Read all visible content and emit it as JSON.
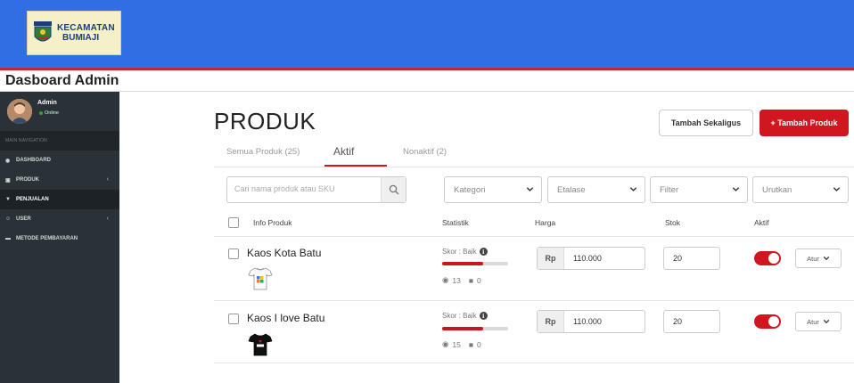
{
  "header": {
    "logo_line1": "KECAMATAN",
    "logo_line2": "BUMIAJI",
    "title": "Dasboard Admin"
  },
  "sidebar": {
    "user_name": "Admin",
    "user_status": "Online",
    "nav_header": "MAIN NAVIGATION",
    "items": [
      {
        "label": "DASHBOARD",
        "icon": "dashboard-icon",
        "has_chevron": false
      },
      {
        "label": "PRODUK",
        "icon": "book-icon",
        "has_chevron": true
      },
      {
        "label": "PENJUALAN",
        "icon": "cart-icon",
        "has_chevron": false,
        "active": true
      },
      {
        "label": "USER",
        "icon": "user-icon",
        "has_chevron": true
      },
      {
        "label": "METODE PEMBAYARAN",
        "icon": "card-icon",
        "has_chevron": false
      }
    ]
  },
  "main": {
    "page_title": "PRODUK",
    "btn_bulk_add": "Tambah Sekaligus",
    "btn_add": "+ Tambah Produk",
    "tabs": [
      {
        "label": "Semua Produk (25)"
      },
      {
        "label": "Aktif",
        "active": true
      },
      {
        "label": "Nonaktif (2)"
      }
    ],
    "search_placeholder": "Cari nama produk atau SKU",
    "filters": [
      "Kategori",
      "Etalase",
      "Filter",
      "Urutkan"
    ],
    "columns": [
      "Info Produk",
      "Statistik",
      "Harga",
      "Stok",
      "Aktif"
    ],
    "products": [
      {
        "name": "Kaos Kota Batu",
        "score_label": "Skor : Baik",
        "score_fraction": 0.62,
        "views": "13",
        "sold": "0",
        "currency": "Rp",
        "price": "110.000",
        "stock": "20",
        "active": true,
        "action": "Atur"
      },
      {
        "name": "Kaos I love Batu",
        "score_label": "Skor : Baik",
        "score_fraction": 0.62,
        "views": "15",
        "sold": "0",
        "currency": "Rp",
        "price": "110.000",
        "stock": "20",
        "active": true,
        "action": "Atur"
      }
    ]
  },
  "colors": {
    "topbar": "#2f6fe3",
    "accent_red": "#d0161e",
    "sidebar": "#2b3237"
  }
}
